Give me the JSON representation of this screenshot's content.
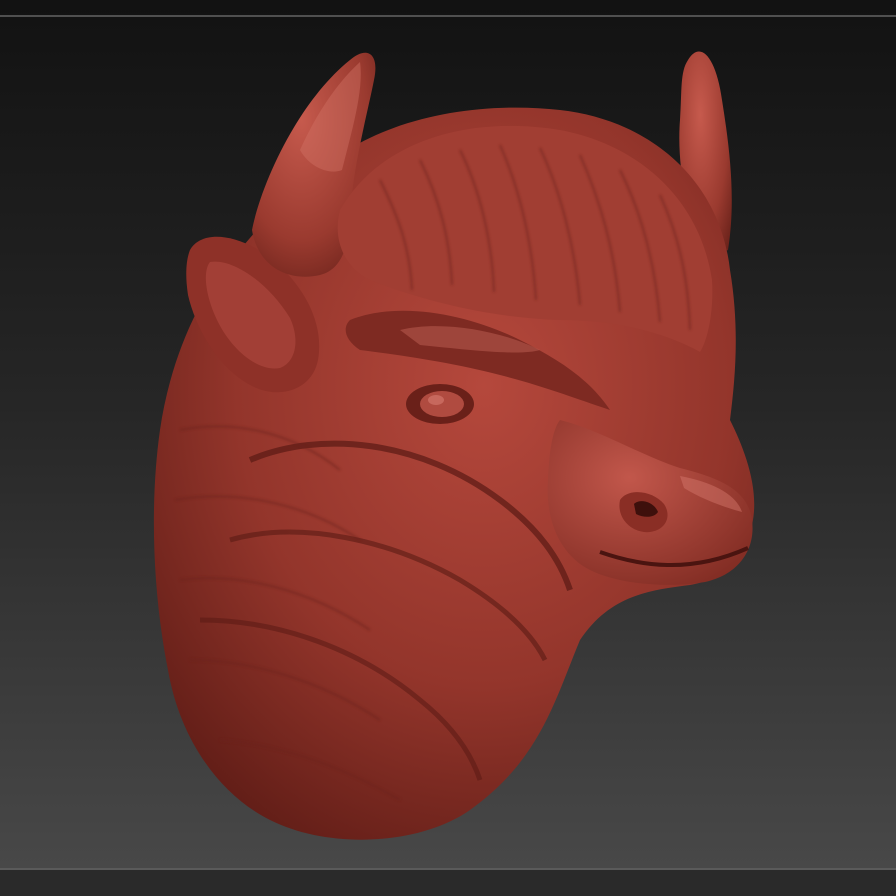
{
  "canvas": {
    "background_top": "#141414",
    "background_bottom": "#4c4c4c",
    "frame_line": "#505050"
  },
  "model": {
    "subject": "bison-head-sculpt",
    "material_color": "#9c3a30",
    "highlight_color": "#c9645a",
    "shadow_color": "#4a1410"
  }
}
